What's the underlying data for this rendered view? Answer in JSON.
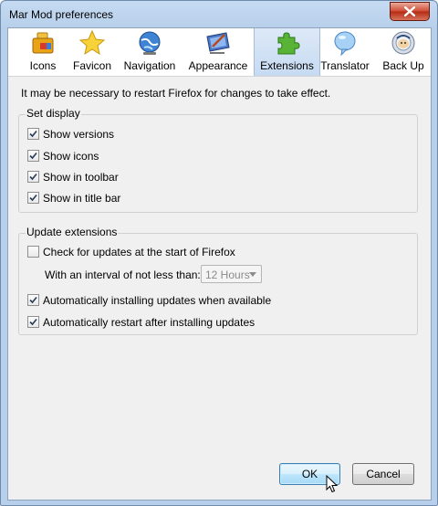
{
  "window": {
    "title": "Mar Mod preferences"
  },
  "tabs": [
    {
      "label": "Icons",
      "icon": "folder-icon"
    },
    {
      "label": "Favicon",
      "icon": "star-icon"
    },
    {
      "label": "Navigation",
      "icon": "globe-icon"
    },
    {
      "label": "Appearance",
      "icon": "monitor-icon"
    },
    {
      "label": "Extensions",
      "icon": "puzzle-icon",
      "selected": true
    },
    {
      "label": "Translator",
      "icon": "speech-bubble-icon"
    },
    {
      "label": "Back Up",
      "icon": "backup-icon"
    }
  ],
  "note": "It may be necessary to restart Firefox for changes to take effect.",
  "set_display": {
    "title": "Set display",
    "items": [
      {
        "label": "Show versions",
        "checked": true
      },
      {
        "label": "Show icons",
        "checked": true
      },
      {
        "label": "Show in toolbar",
        "checked": true
      },
      {
        "label": "Show in title bar",
        "checked": true
      }
    ]
  },
  "update_extensions": {
    "title": "Update extensions",
    "check_updates": {
      "label": "Check for updates at the start of Firefox",
      "checked": false
    },
    "interval_label": "With an interval of not less than:",
    "interval_value": "12 Hours",
    "auto_install": {
      "label": "Automatically installing updates when available",
      "checked": true
    },
    "auto_restart": {
      "label": "Automatically restart after installing updates",
      "checked": true
    }
  },
  "buttons": {
    "ok": "OK",
    "cancel": "Cancel"
  },
  "colors": {
    "accent": "#3c7fb1",
    "selected_tab": "#c6daf2",
    "titlebar": "#b7cfea"
  }
}
